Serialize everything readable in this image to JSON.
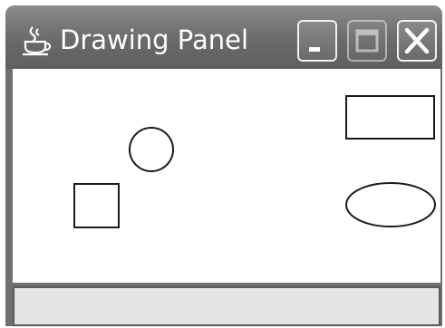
{
  "window": {
    "title": "Drawing Panel",
    "app_icon": "java-cup-icon",
    "controls": {
      "minimize": "minimize-icon",
      "maximize": "maximize-icon",
      "close": "close-icon"
    }
  },
  "canvas": {
    "shapes": [
      {
        "kind": "circle",
        "name": "circle-shape"
      },
      {
        "kind": "square",
        "name": "square-shape"
      },
      {
        "kind": "rectangle",
        "name": "rectangle-shape"
      },
      {
        "kind": "ellipse",
        "name": "ellipse-shape"
      }
    ]
  },
  "colors": {
    "titlebar": "#6a6a6a",
    "canvas": "#ffffff",
    "stroke": "#1a1a1a",
    "statusbar": "#e4e4e4"
  }
}
